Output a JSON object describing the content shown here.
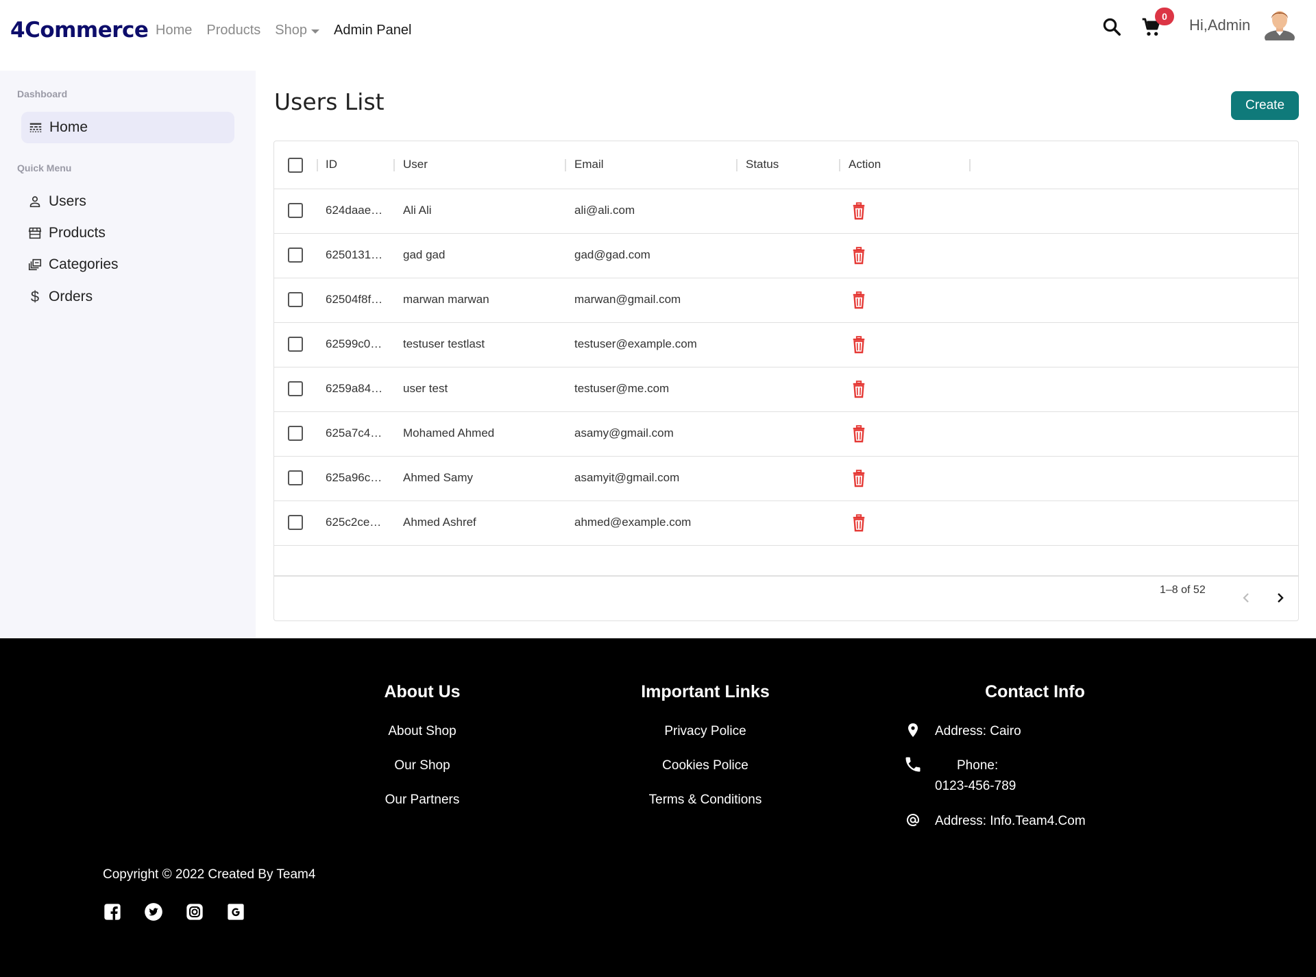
{
  "navbar": {
    "brand": "4Commerce",
    "links": [
      {
        "label": "Home"
      },
      {
        "label": "Products"
      },
      {
        "label": "Shop"
      },
      {
        "label": "Admin Panel"
      }
    ],
    "cart_count": "0",
    "greeting": "Hi,Admin"
  },
  "sidebar": {
    "section_dashboard": "Dashboard",
    "home_label": "Home",
    "section_quick": "Quick Menu",
    "items": [
      {
        "label": "Users",
        "icon": "user-icon"
      },
      {
        "label": "Products",
        "icon": "store-icon"
      },
      {
        "label": "Categories",
        "icon": "categories-icon"
      },
      {
        "label": "Orders",
        "icon": "dollar-icon"
      }
    ]
  },
  "main": {
    "title": "Users List",
    "create_label": "Create",
    "columns": [
      "ID",
      "User",
      "Email",
      "Status",
      "Action"
    ],
    "rows": [
      {
        "id": "624daae…",
        "user": "Ali Ali",
        "email": "ali@ali.com"
      },
      {
        "id": "6250131…",
        "user": "gad gad",
        "email": "gad@gad.com"
      },
      {
        "id": "62504f8f…",
        "user": "marwan marwan",
        "email": "marwan@gmail.com"
      },
      {
        "id": "62599c0…",
        "user": "testuser testlast",
        "email": "testuser@example.com"
      },
      {
        "id": "6259a84…",
        "user": "user test",
        "email": "testuser@me.com"
      },
      {
        "id": "625a7c4…",
        "user": "Mohamed Ahmed",
        "email": "asamy@gmail.com"
      },
      {
        "id": "625a96c…",
        "user": "Ahmed Samy",
        "email": "asamyit@gmail.com"
      },
      {
        "id": "625c2ce…",
        "user": "Ahmed Ashref",
        "email": "ahmed@example.com"
      }
    ],
    "pagination": "1–8 of 52"
  },
  "footer": {
    "about": {
      "title": "About Us",
      "links": [
        "About Shop",
        "Our Shop",
        "Our Partners"
      ]
    },
    "important": {
      "title": "Important Links",
      "links": [
        "Privacy Police",
        "Cookies Police",
        "Terms & Conditions"
      ]
    },
    "contact": {
      "title": "Contact Info",
      "address": "Address: Cairo",
      "phone_label": "Phone:",
      "phone": "0123-456-789",
      "email": "Address: Info.Team4.Com"
    },
    "copyright": "Copyright © 2022 Created By Team4",
    "social": [
      "facebook-icon",
      "twitter-icon",
      "instagram-icon",
      "google-icon"
    ]
  },
  "colors": {
    "brand": "#0d0d6b",
    "accent": "#0f7a7a",
    "danger": "#dc3545",
    "trash": "#e53935"
  }
}
